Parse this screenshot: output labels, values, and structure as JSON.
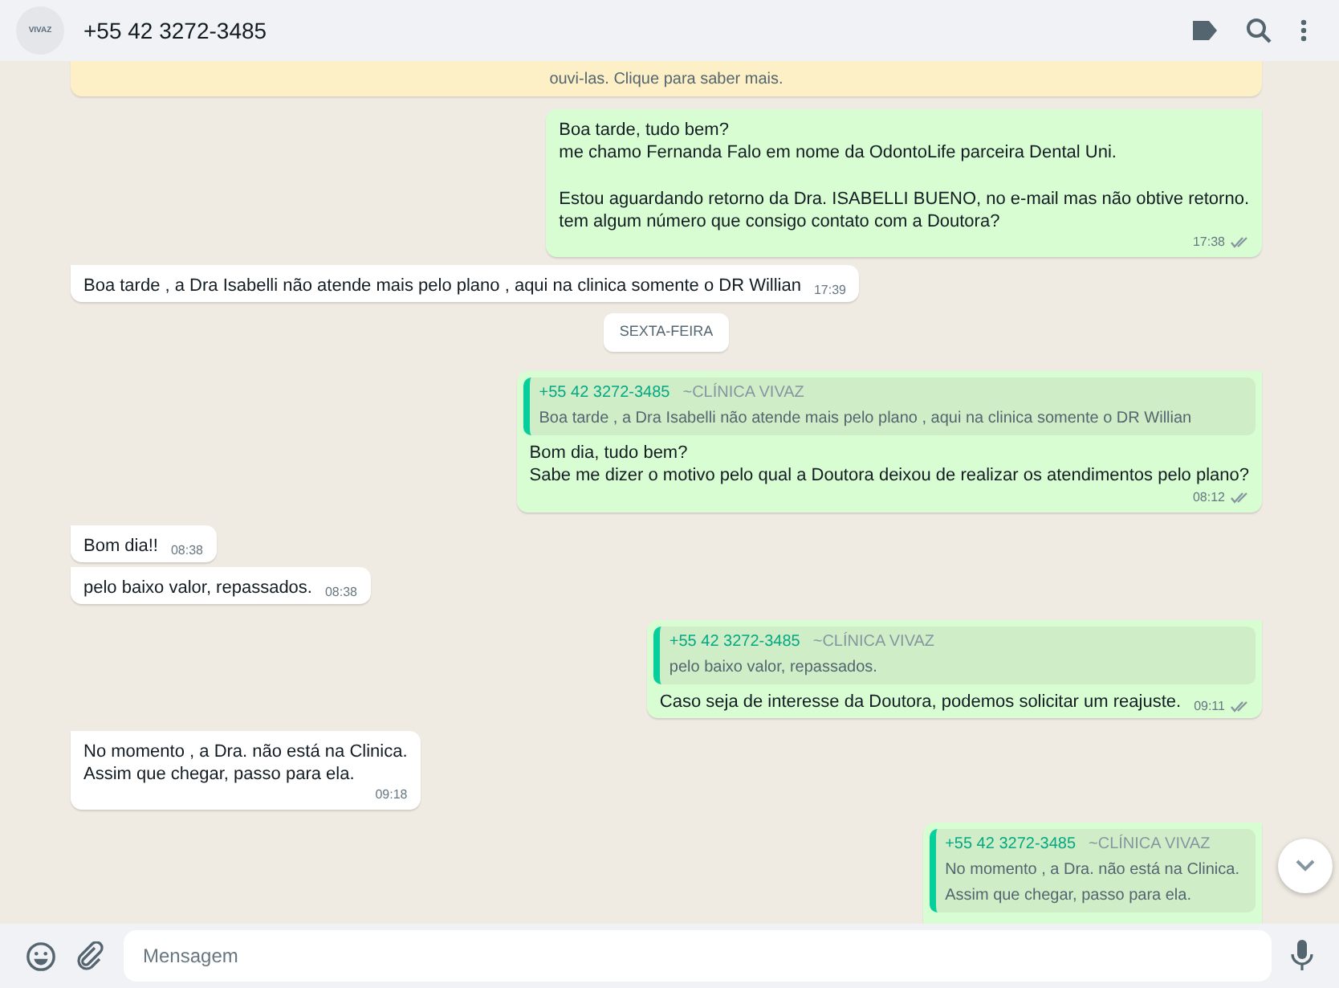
{
  "header": {
    "avatar_text": "VIVAZ",
    "title": "+55 42 3272-3485"
  },
  "banner": {
    "text": "ouvi-las. Clique para saber mais."
  },
  "messages": [
    {
      "kind": "out",
      "paragraphs": [
        [
          "Boa tarde, tudo bem?",
          "me chamo Fernanda Falo em nome da OdontoLife parceira Dental Uni."
        ],
        [
          "Estou aguardando retorno da Dra. ISABELLI BUENO, no e-mail mas não obtive retorno.",
          "tem algum número que consigo contato com a Doutora?"
        ]
      ],
      "time": "17:38",
      "read": false
    },
    {
      "kind": "in",
      "lines": [
        "Boa tarde , a Dra Isabelli não atende mais pelo plano , aqui na clinica somente o DR Willian"
      ],
      "time": "17:39"
    },
    {
      "kind": "date",
      "text": "SEXTA-FEIRA"
    },
    {
      "kind": "out",
      "quote": {
        "phone": "+55 42 3272-3485",
        "name": "~CLÍNICA VIVAZ",
        "lines": [
          "Boa tarde , a Dra Isabelli não atende mais pelo plano , aqui na clinica somente o DR Willian"
        ]
      },
      "lines": [
        "Bom dia, tudo bem?",
        "Sabe me dizer o motivo pelo qual a Doutora deixou de realizar os atendimentos pelo plano?"
      ],
      "time": "08:12",
      "read": false
    },
    {
      "kind": "in",
      "lines": [
        "Bom dia!!"
      ],
      "time": "08:38"
    },
    {
      "kind": "in",
      "lines": [
        "pelo baixo valor, repassados."
      ],
      "time": "08:38"
    },
    {
      "kind": "out",
      "quote": {
        "phone": "+55 42 3272-3485",
        "name": "~CLÍNICA VIVAZ",
        "lines": [
          "pelo baixo valor, repassados."
        ]
      },
      "lines": [
        "Caso seja de interesse da Doutora, podemos solicitar um reajuste."
      ],
      "time": "09:11",
      "read": false
    },
    {
      "kind": "in",
      "lines": [
        "No momento , a Dra. não está na Clinica.",
        "Assim que chegar, passo para ela."
      ],
      "time": "09:18"
    },
    {
      "kind": "out",
      "quote": {
        "phone": "+55 42 3272-3485",
        "name": "~CLÍNICA VIVAZ",
        "lines": [
          "No momento , a Dra. não está na Clinica.",
          "Assim que chegar, passo para ela."
        ]
      }
    }
  ],
  "composer": {
    "placeholder": "Mensagem"
  }
}
